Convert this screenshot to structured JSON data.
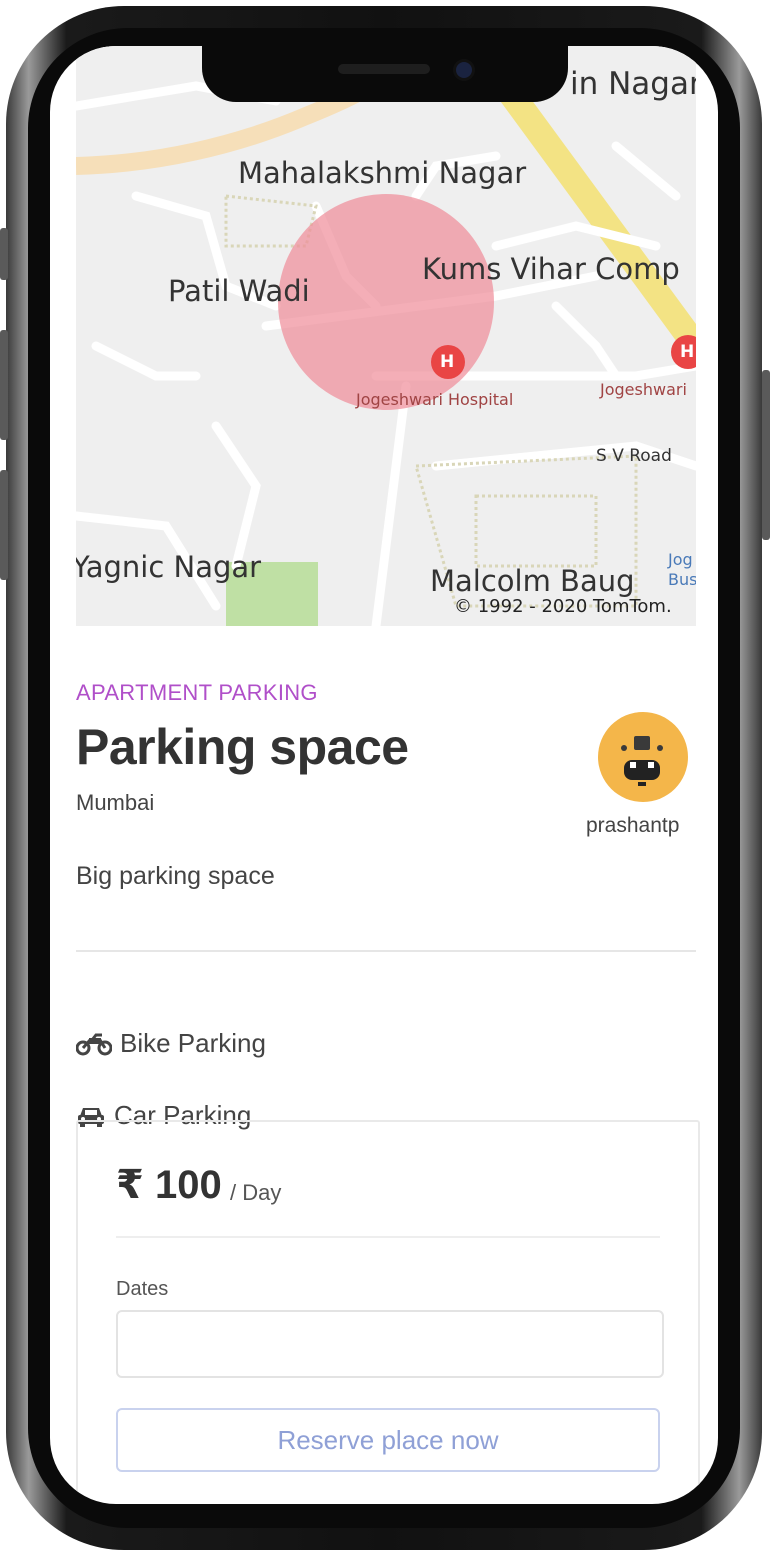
{
  "map": {
    "labels": [
      "in Nagar",
      "Mahalakshmi Nagar",
      "Patil Wadi",
      "Kums Vihar Comp",
      "Jogeshwari Hospital",
      "Jogeshwari",
      "S V Road",
      "Yagnic Nagar",
      "Malcolm Baug",
      "Jog",
      "Bus"
    ],
    "attribution": "© 1992 - 2020 TomTom.",
    "poi_letter": "H"
  },
  "listing": {
    "category": "APARTMENT PARKING",
    "title": "Parking space",
    "city": "Mumbai",
    "description": "Big parking space",
    "host": "prashantp"
  },
  "features": [
    {
      "icon": "motorcycle-icon",
      "label": "Bike Parking"
    },
    {
      "icon": "car-icon",
      "label": "Car Parking"
    }
  ],
  "booking": {
    "price": "₹ 100",
    "per": "/ Day",
    "dates_label": "Dates",
    "dates_value": "",
    "reserve_label": "Reserve place now"
  },
  "colors": {
    "category": "#b04fc9",
    "accent_button": "#8fa0d6",
    "avatar": "#f4b64a",
    "map_circle": "#f08c98"
  }
}
